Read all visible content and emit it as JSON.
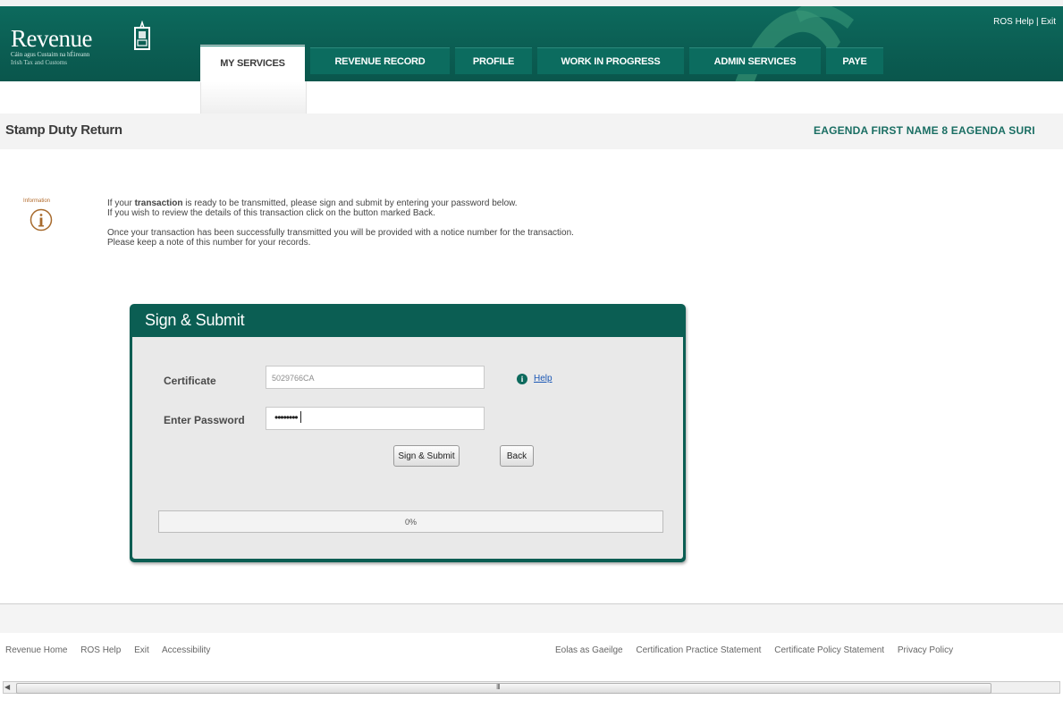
{
  "header": {
    "brand": "Revenue",
    "tagline_irish": "Cáin agus Custaim na hÉireann",
    "tagline_english": "Irish Tax and Customs",
    "top_links": [
      "ROS Help",
      "Exit"
    ],
    "top_links_sep": "|",
    "tabs": [
      {
        "label": "MY SERVICES",
        "active": true
      },
      {
        "label": "REVENUE RECORD",
        "active": false
      },
      {
        "label": "PROFILE",
        "active": false
      },
      {
        "label": "WORK IN PROGRESS",
        "active": false
      },
      {
        "label": "ADMIN SERVICES",
        "active": false
      },
      {
        "label": "PAYE",
        "active": false
      }
    ]
  },
  "page": {
    "title": "Stamp Duty  Return",
    "user_name": "EAGENDA FIRST NAME 8 EAGENDA SURI"
  },
  "info": {
    "icon_label": "Information",
    "line1_pre": "If your ",
    "line1_bold": "transaction",
    "line1_post": " is ready to be transmitted, please sign and submit by entering your password below.",
    "line2": "If you wish to review the details of this transaction click on the button marked Back.",
    "line3": "Once your transaction has been successfully transmitted you will be provided with a notice number for the transaction.",
    "line4": "Please keep a note of this number for your records."
  },
  "sign_submit": {
    "heading": "Sign & Submit",
    "certificate_label": "Certificate",
    "certificate_value": "5029766CA",
    "password_label": "Enter Password",
    "password_value": "••••••••",
    "help_label": "Help",
    "submit_label": "Sign & Submit",
    "back_label": "Back",
    "progress_text": "0%",
    "progress_value": 0
  },
  "footer": {
    "left_links": [
      "Revenue Home",
      "ROS Help",
      "Exit",
      "Accessibility"
    ],
    "right_links": [
      "Eolas as Gaeilge",
      "Certification Practice Statement",
      "Certificate Policy Statement",
      "Privacy Policy"
    ]
  },
  "scrollbar": {
    "grip": "III",
    "left_arrow": "◀"
  },
  "colors": {
    "brand_green": "#0d6a5d",
    "panel_green": "#0b5e53",
    "link_blue": "#1a57b5"
  }
}
